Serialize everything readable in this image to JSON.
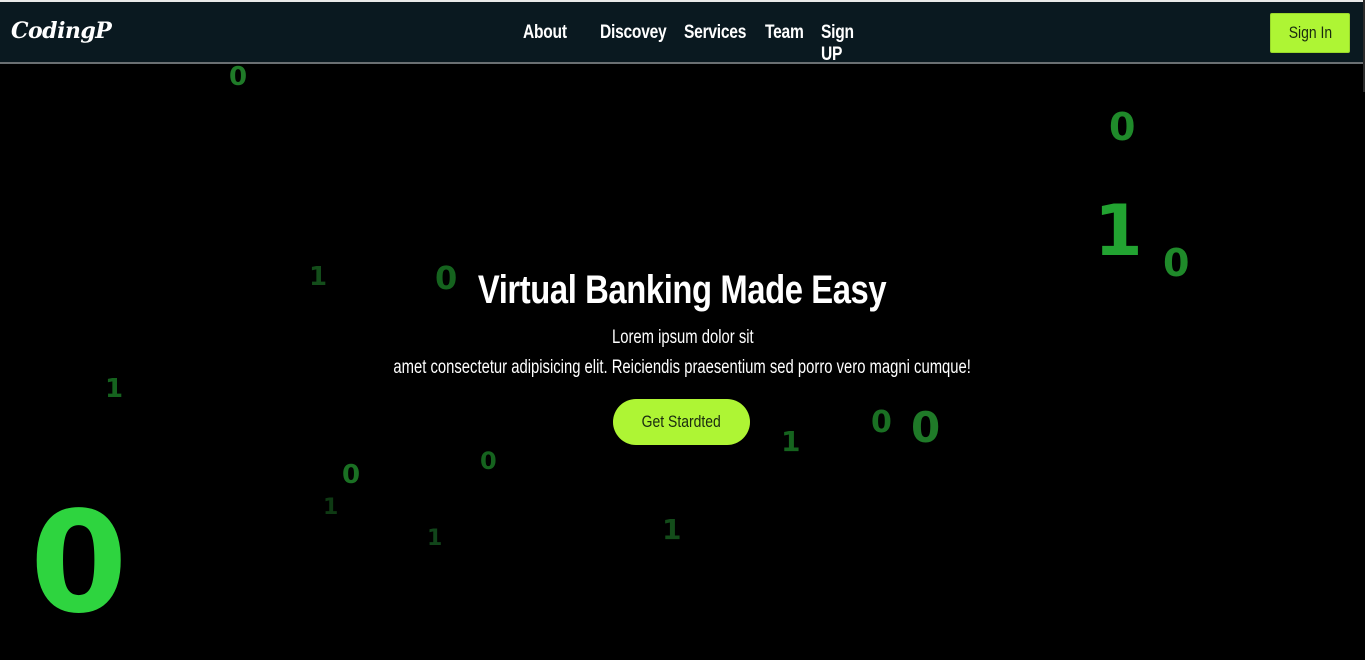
{
  "nav": {
    "logo": "CodingP",
    "links": [
      "About",
      "Discovey",
      "Services",
      "Team",
      "Sign UP"
    ],
    "signin_label": "Sign In"
  },
  "hero": {
    "title": "Virtual Banking Made Easy",
    "line1": "Lorem ipsum dolor sit",
    "line2": "amet consectetur adipisicing elit. Reiciendis praesentium sed porro vero magni cumque!",
    "cta_label": "Get Stardted"
  },
  "background_digits": [
    "0",
    "0",
    "1",
    "0",
    "1",
    "0",
    "1",
    "0",
    "0",
    "1",
    "0",
    "0",
    "1",
    "1",
    "1",
    "0"
  ],
  "colors": {
    "navbar_bg": "#0a1920",
    "accent": "#aef534",
    "digit_green": "#2ed43f",
    "page_bg": "#000000"
  }
}
